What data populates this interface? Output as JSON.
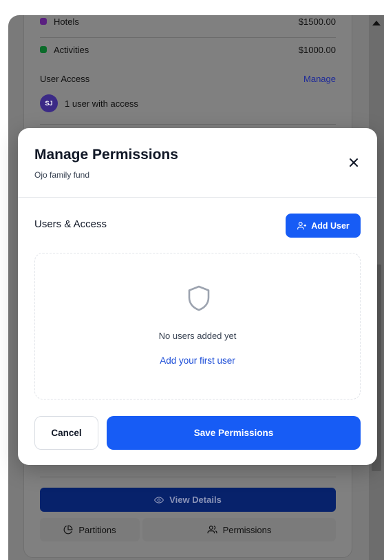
{
  "background": {
    "budget_items": [
      {
        "label": "Hotels",
        "amount": "$1500.00",
        "color": "#5a2080"
      },
      {
        "label": "Activities",
        "amount": "$1000.00",
        "color": "#0b6b2a"
      }
    ],
    "user_access": {
      "title": "User Access",
      "manage_label": "Manage",
      "avatar_initials": "SJ",
      "access_text": "1 user with access"
    },
    "view_details_label": "View Details",
    "tabs": {
      "partitions_label": "Partitions",
      "permissions_label": "Permissions"
    }
  },
  "modal": {
    "title": "Manage Permissions",
    "subtitle": "Ojo family fund",
    "section_title": "Users & Access",
    "add_user_label": "Add User",
    "empty_state": {
      "message": "No users added yet",
      "cta_label": "Add your first user"
    },
    "cancel_label": "Cancel",
    "save_label": "Save Permissions"
  },
  "colors": {
    "primary": "#175cf5",
    "link": "#1d4ed8"
  }
}
